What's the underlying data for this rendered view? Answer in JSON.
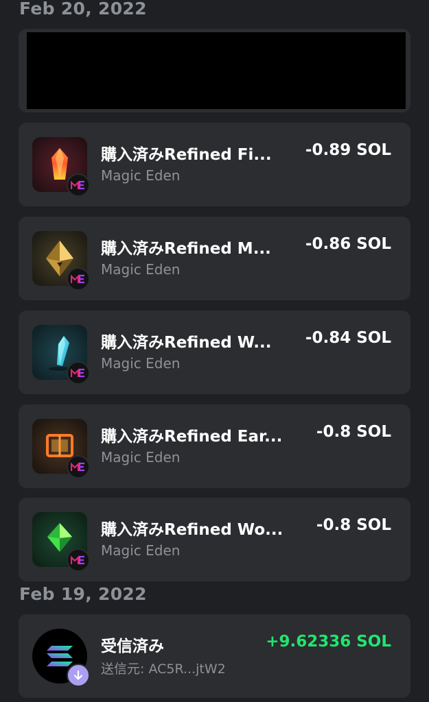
{
  "groups": [
    {
      "date": "Feb 20, 2022",
      "transactions": [
        {
          "title": "購入済みRefined Fi...",
          "subtitle": "Magic Eden",
          "amount": "-0.89 SOL",
          "icon": "red-crystal-nft-icon"
        },
        {
          "title": "購入済みRefined M...",
          "subtitle": "Magic Eden",
          "amount": "-0.86 SOL",
          "icon": "gold-pyramid-nft-icon"
        },
        {
          "title": "購入済みRefined W...",
          "subtitle": "Magic Eden",
          "amount": "-0.84 SOL",
          "icon": "blue-crystal-nft-icon"
        },
        {
          "title": "購入済みRefined Ear...",
          "subtitle": "Magic Eden",
          "amount": "-0.8 SOL",
          "icon": "orange-cube-nft-icon"
        },
        {
          "title": "購入済みRefined Wo...",
          "subtitle": "Magic Eden",
          "amount": "-0.8 SOL",
          "icon": "green-gem-nft-icon"
        }
      ]
    },
    {
      "date": "Feb 19, 2022",
      "transactions": [
        {
          "title": "受信済み",
          "subtitle": "送信元: AC5R...jtW2",
          "amount": "+9.62336 SOL",
          "icon": "solana-logo-icon"
        }
      ]
    }
  ],
  "badge_icon": "magic-eden-icon",
  "colors": {
    "background": "#1e2023",
    "card": "#2b2d30",
    "positive": "#21e56f",
    "muted": "#8e9196",
    "magic_eden": "#e42575"
  }
}
